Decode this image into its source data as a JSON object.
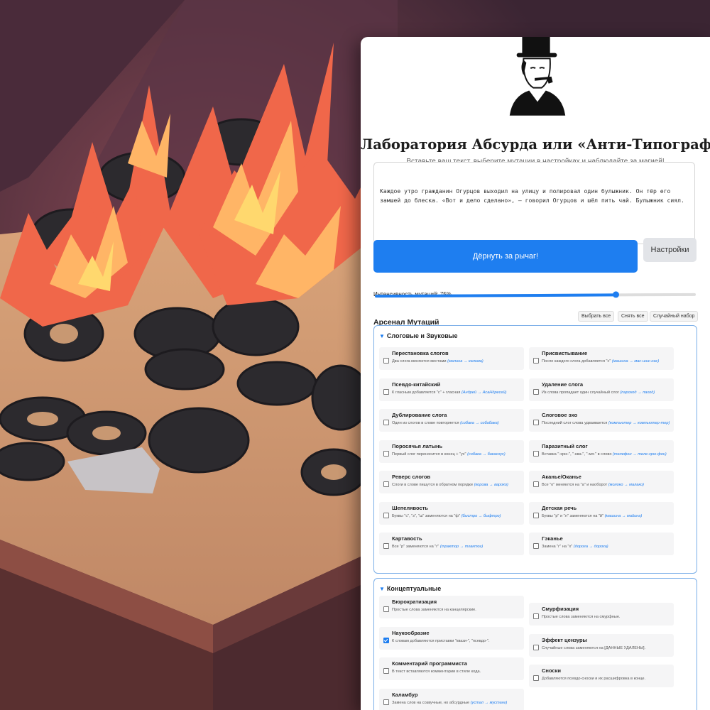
{
  "app": {
    "title": "Лаборатория Абсурда или «Анти-Типограф»",
    "subtitle": "Вставьте ваш текст, выберите мутации в настройках и наблюдайте за магией!"
  },
  "input": {
    "value": "Каждое утро гражданин Огурцов выходил на улицу и полировал один булыжник. Он тёр его замшей до блеска. «Вот и дело сделано», — говорил Огурцов и шёл пить чай. Булыжник сиял."
  },
  "actions": {
    "lever_label": "Дёрнуть за рычаг!",
    "settings_label": "Настройки"
  },
  "intensity": {
    "label": "Интенсивность мутаций: 75%",
    "value": 75
  },
  "arsenal": {
    "title": "Арсенал Мутаций",
    "select_all": "Выбрать все",
    "deselect_all": "Снять все",
    "random_set": "Случайный набор"
  },
  "sections": [
    {
      "title": "Слоговые и Звуковые",
      "left": [
        {
          "name": "Перестановка слогов",
          "desc": "Два слога меняются местами",
          "example": "(малина → калима)",
          "checked": false
        },
        {
          "name": "Псевдо-китайский",
          "desc": "К гласным добавляется \"с\" + гласная",
          "example": "(Андрей → АсаНдресей)",
          "checked": false
        },
        {
          "name": "Дублирование слога",
          "desc": "Один из слогов в слове повторяется",
          "example": "(собака → собабака)",
          "checked": false
        },
        {
          "name": "Поросячья латынь",
          "desc": "Первый слог переносится в конец + \"ус\"",
          "example": "(собака → бакасоус)",
          "checked": false
        },
        {
          "name": "Реверс слогов",
          "desc": "Слоги в слове пишутся в обратном порядке",
          "example": "(корова → варoко)",
          "checked": false
        },
        {
          "name": "Шепелявость",
          "desc": "Буквы \"с\", \"з\", \"ш\" заменяются на \"ф\"",
          "example": "(быстро → быфтро)",
          "checked": false
        },
        {
          "name": "Картавость",
          "desc": "Все \"р\" заменяются на \"г\"",
          "example": "(трактор → тгактог)",
          "checked": false
        }
      ],
      "right": [
        {
          "name": "Присвистывание",
          "desc": "После каждого слога добавляется \"с\"",
          "example": "(машина → мас-шис-нас)",
          "checked": false
        },
        {
          "name": "Удаление слога",
          "desc": "Из слова пропадает один случайный слог",
          "example": "(пароход → паход)",
          "checked": false
        },
        {
          "name": "Слоговое эхо",
          "desc": "Последний слог слова удваивается",
          "example": "(компьютер → компьютер-тер)",
          "checked": false
        },
        {
          "name": "Паразитный слог",
          "desc": "Вставка \"-хрю-\", \"-ква-\", \"-мя-\" в слово",
          "example": "(телефон → теле-хрю-фон)",
          "checked": false
        },
        {
          "name": "Аканье/Оканье",
          "desc": "Все \"о\" меняются на \"а\" и наоборот",
          "example": "(молоко → малако)",
          "checked": false
        },
        {
          "name": "Детская речь",
          "desc": "Буквы \"р\" и \"л\" заменяются на \"й\"",
          "example": "(машина → майина)",
          "checked": false
        },
        {
          "name": "Гэканье",
          "desc": "Замена \"г\" на \"х\"",
          "example": "(дорога → дороха)",
          "checked": false
        }
      ]
    },
    {
      "title": "Концептуальные",
      "left": [
        {
          "name": "Бюрократизация",
          "desc": "Простые слова заменяются на канцелярские.",
          "example": "",
          "checked": false
        },
        {
          "name": "Наукообразие",
          "desc": "К словам добавляются приставки \"квази-\", \"псевдо-\".",
          "example": "",
          "checked": true
        },
        {
          "name": "Комментарий программиста",
          "desc": "В текст вставляются комментарии в стиле кода.",
          "example": "",
          "checked": false
        },
        {
          "name": "Каламбур",
          "desc": "Замена слов на созвучные, но абсурдные",
          "example": "(устал → мустанг)",
          "checked": false
        }
      ],
      "right": [
        {
          "name": "Смурфизация",
          "desc": "Простые слова заменяются на смурфные.",
          "example": "",
          "checked": false
        },
        {
          "name": "Эффект цензуры",
          "desc": "Случайные слова заменяются на [ДАННЫЕ УДАЛЕНЫ].",
          "example": "",
          "checked": false
        },
        {
          "name": "Сноски",
          "desc": "Добавляются псевдо-сноски и их расшифровка в конце.",
          "example": "",
          "checked": false
        }
      ]
    }
  ]
}
